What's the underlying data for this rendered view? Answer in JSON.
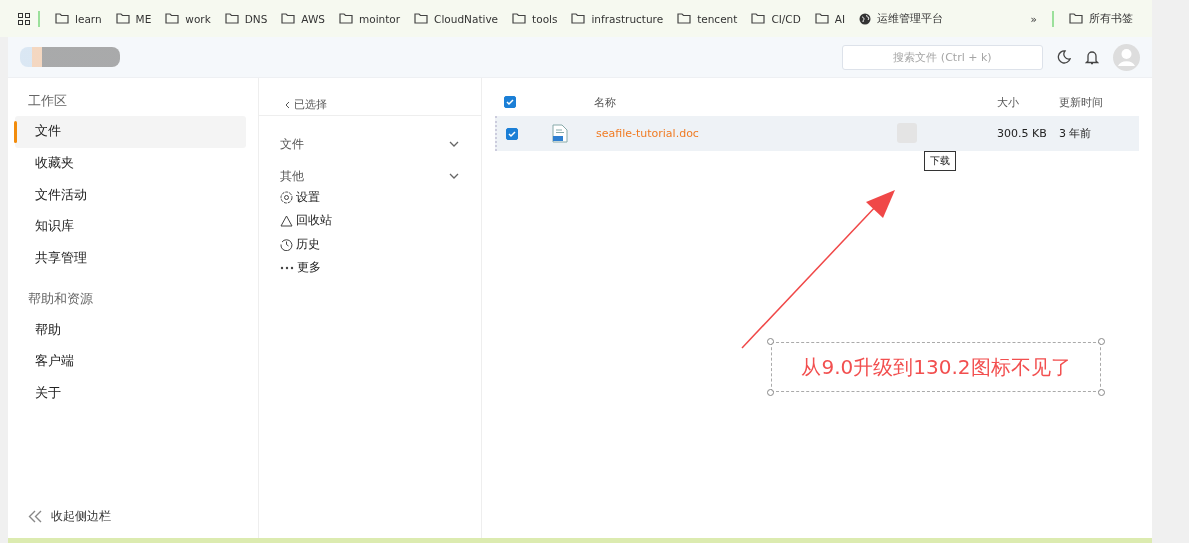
{
  "bookmarks": [
    {
      "label": "learn",
      "kind": "folder"
    },
    {
      "label": "ME",
      "kind": "folder"
    },
    {
      "label": "work",
      "kind": "folder"
    },
    {
      "label": "DNS",
      "kind": "folder"
    },
    {
      "label": "AWS",
      "kind": "folder"
    },
    {
      "label": "mointor",
      "kind": "folder"
    },
    {
      "label": "CloudNative",
      "kind": "folder"
    },
    {
      "label": "tools",
      "kind": "folder"
    },
    {
      "label": "infrastructure",
      "kind": "folder"
    },
    {
      "label": "tencent",
      "kind": "folder"
    },
    {
      "label": "CI/CD",
      "kind": "folder"
    },
    {
      "label": "AI",
      "kind": "folder"
    },
    {
      "label": "运维管理平台",
      "kind": "globe"
    }
  ],
  "bookmarks_overflow": "»",
  "all_bookmarks": "所有书签",
  "header": {
    "search": {
      "placeholder": "搜索文件 (Ctrl + k)"
    }
  },
  "sidebar": {
    "sections": [
      {
        "title": "工作区",
        "items": [
          {
            "label": "文件",
            "selected": true
          },
          {
            "label": "收藏夹",
            "selected": false
          },
          {
            "label": "文件活动",
            "selected": false
          },
          {
            "label": "知识库",
            "selected": false
          },
          {
            "label": "共享管理",
            "selected": false
          }
        ]
      },
      {
        "title": "帮助和资源",
        "items": [
          {
            "label": "帮助",
            "selected": false
          },
          {
            "label": "客户端",
            "selected": false
          },
          {
            "label": "关于",
            "selected": false
          }
        ]
      }
    ],
    "collapse": "收起侧边栏"
  },
  "nav_panel": {
    "breadcrumb": "已选择",
    "groups": [
      {
        "title": "文件"
      },
      {
        "title": "其他",
        "items": [
          {
            "label": "设置",
            "kind": "settings"
          },
          {
            "label": "回收站",
            "kind": "trash"
          },
          {
            "label": "历史",
            "kind": "history"
          },
          {
            "label": "更多",
            "kind": "more"
          }
        ]
      }
    ]
  },
  "table": {
    "all_checked": true,
    "columns": [
      "名称",
      "大小",
      "更新时间"
    ],
    "rows": [
      {
        "name": "seafile-tutorial.doc",
        "size": "300.5 KB",
        "updated": "3 年前",
        "checked": true,
        "tooltip": "下载"
      }
    ]
  },
  "annotation": {
    "text": "从9.0升级到130.2图标不见了"
  }
}
